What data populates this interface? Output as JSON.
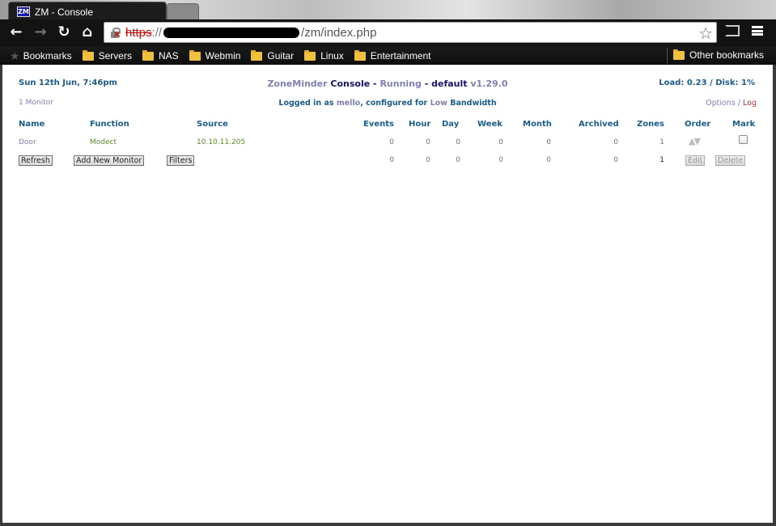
{
  "browser": {
    "tab_title": "ZM - Console",
    "tab_favicon": "ZM",
    "url_scheme": "https",
    "url_sep": "://",
    "url_path": "/zm/index.php"
  },
  "bookmarks": {
    "items": [
      {
        "label": "Bookmarks"
      },
      {
        "label": "Servers"
      },
      {
        "label": "NAS"
      },
      {
        "label": "Webmin"
      },
      {
        "label": "Guitar"
      },
      {
        "label": "Linux"
      },
      {
        "label": "Entertainment"
      }
    ],
    "other": "Other bookmarks"
  },
  "header": {
    "datetime": "Sun 12th Jun, 7:46pm",
    "app": "ZoneMinder",
    "section": "Console",
    "dash1": " - ",
    "state": "Running",
    "dash2": " - ",
    "run_state": "default",
    "version": "v1.29.0",
    "load": "Load: 0.23 / Disk: 1%"
  },
  "subheader": {
    "monitor_count": "1 Monitor",
    "logged_in_prefix": "Logged in as",
    "user": "mello",
    "configured_for": ", configured for",
    "bandwidth": "Low",
    "bandwidth_suffix": "Bandwidth",
    "options": "Options",
    "slash": " / ",
    "log": "Log"
  },
  "table": {
    "headers": {
      "name": "Name",
      "function": "Function",
      "source": "Source",
      "events": "Events",
      "hour": "Hour",
      "day": "Day",
      "week": "Week",
      "month": "Month",
      "archived": "Archived",
      "zones": "Zones",
      "order": "Order",
      "mark": "Mark"
    },
    "rows": [
      {
        "name": "Door",
        "function": "Modect",
        "source": "10.10.11.205",
        "events": "0",
        "hour": "0",
        "day": "0",
        "week": "0",
        "month": "0",
        "archived": "0",
        "zones": "1"
      }
    ],
    "footer": {
      "events": "0",
      "hour": "0",
      "day": "0",
      "week": "0",
      "month": "0",
      "archived": "0",
      "zones": "1"
    }
  },
  "buttons": {
    "refresh": "Refresh",
    "add_monitor": "Add New Monitor",
    "filters": "Filters",
    "edit": "Edit",
    "delete": "Delete"
  }
}
